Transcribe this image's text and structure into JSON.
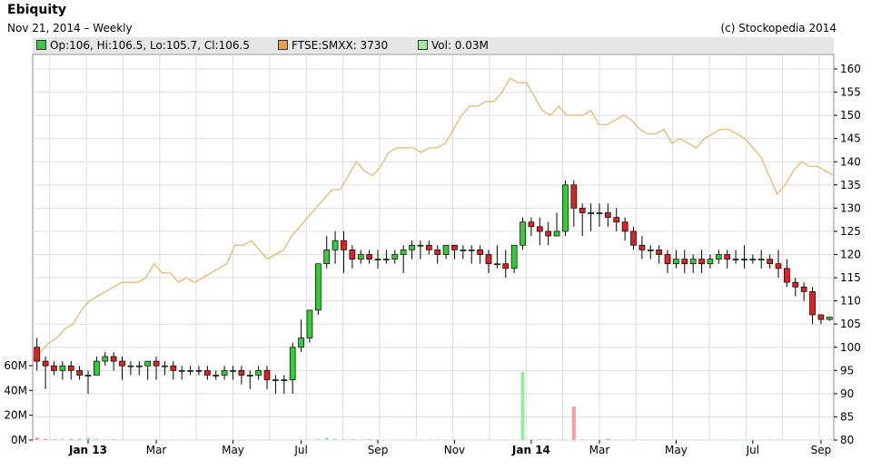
{
  "header": {
    "title": "Ebiquity",
    "subtitle": "Nov 21, 2014 – Weekly",
    "credit": "(c) Stockopedia 2014"
  },
  "legend": {
    "ohlc": "Op:106, Hi:106.5, Lo:105.7, Cl:106.5",
    "index": "FTSE:SMXX: 3730",
    "volume": "Vol: 0.03M"
  },
  "colors": {
    "up": "#33cc33",
    "down": "#dd2222",
    "index_line": "#e8b96a",
    "volume_up": "#99ee99",
    "volume_down": "#ff9999",
    "legend_bg": "#e6e6e6"
  },
  "chart_data": {
    "type": "line",
    "price_axis": {
      "ticks": [
        "160",
        "155",
        "150",
        "145",
        "140",
        "135",
        "130",
        "125",
        "120",
        "115",
        "110",
        "105",
        "100",
        "95",
        "90",
        "85",
        "80"
      ],
      "ylim": [
        80,
        160
      ]
    },
    "volume_axis": {
      "ticks": [
        "60M",
        "40M",
        "20M",
        "0M"
      ],
      "ylim": [
        0,
        60
      ]
    },
    "x_ticks": [
      {
        "label": "Jan 13",
        "bold": true,
        "i": 6
      },
      {
        "label": "Mar",
        "bold": false,
        "i": 14
      },
      {
        "label": "May",
        "bold": false,
        "i": 23
      },
      {
        "label": "Jul",
        "bold": false,
        "i": 31
      },
      {
        "label": "Sep",
        "bold": false,
        "i": 40
      },
      {
        "label": "Nov",
        "bold": false,
        "i": 49
      },
      {
        "label": "Jan 14",
        "bold": true,
        "i": 58
      },
      {
        "label": "Mar",
        "bold": false,
        "i": 66
      },
      {
        "label": "May",
        "bold": false,
        "i": 75
      },
      {
        "label": "Jul",
        "bold": false,
        "i": 84
      },
      {
        "label": "Sep",
        "bold": false,
        "i": 92
      },
      {
        "label": "Nov",
        "bold": false,
        "i": 101
      }
    ],
    "ohlc": [
      [
        100,
        102,
        95,
        97
      ],
      [
        97,
        98,
        91,
        96
      ],
      [
        96,
        97,
        94,
        95
      ],
      [
        95,
        97,
        93,
        96
      ],
      [
        96,
        97,
        93,
        95
      ],
      [
        95,
        96,
        93,
        94
      ],
      [
        94,
        95,
        90,
        94
      ],
      [
        94,
        98,
        94,
        97
      ],
      [
        97,
        99,
        96,
        98
      ],
      [
        98,
        99,
        95,
        97
      ],
      [
        97,
        98,
        93,
        96
      ],
      [
        96,
        97,
        94,
        96
      ],
      [
        96,
        97,
        94,
        96
      ],
      [
        96,
        97,
        93,
        97
      ],
      [
        97,
        98,
        93,
        96
      ],
      [
        96,
        97,
        94,
        96
      ],
      [
        96,
        97,
        93,
        95
      ],
      [
        95,
        96,
        93,
        95
      ],
      [
        95,
        96,
        94,
        95
      ],
      [
        95,
        96,
        94,
        95
      ],
      [
        95,
        96,
        93,
        94
      ],
      [
        94,
        95,
        93,
        94
      ],
      [
        94,
        96,
        93,
        95
      ],
      [
        95,
        96,
        93,
        95
      ],
      [
        95,
        96,
        92,
        94
      ],
      [
        94,
        95,
        91,
        94
      ],
      [
        94,
        96,
        93,
        95
      ],
      [
        95,
        96,
        91,
        93
      ],
      [
        93,
        94,
        90,
        93
      ],
      [
        93,
        94,
        90,
        93
      ],
      [
        93,
        101,
        90,
        100
      ],
      [
        100,
        106,
        99,
        102
      ],
      [
        102,
        108,
        101,
        108
      ],
      [
        108,
        118,
        107,
        118
      ],
      [
        118,
        124,
        117,
        121
      ],
      [
        121,
        125,
        118,
        123
      ],
      [
        123,
        125,
        116,
        121
      ],
      [
        121,
        122,
        117,
        119
      ],
      [
        119,
        121,
        118,
        120
      ],
      [
        120,
        121,
        118,
        119
      ],
      [
        119,
        121,
        117,
        119
      ],
      [
        119,
        121,
        118,
        119
      ],
      [
        119,
        121,
        118,
        120
      ],
      [
        120,
        122,
        116,
        121
      ],
      [
        121,
        123,
        119,
        122
      ],
      [
        122,
        123,
        119,
        122
      ],
      [
        122,
        123,
        120,
        121
      ],
      [
        121,
        122,
        118,
        120
      ],
      [
        120,
        122,
        119,
        122
      ],
      [
        122,
        122,
        119,
        121
      ],
      [
        121,
        122,
        119,
        121
      ],
      [
        121,
        122,
        118,
        121
      ],
      [
        121,
        122,
        118,
        120
      ],
      [
        120,
        121,
        116,
        118
      ],
      [
        118,
        122,
        117,
        118
      ],
      [
        118,
        121,
        115,
        117
      ],
      [
        117,
        122,
        116,
        122
      ],
      [
        122,
        128,
        121,
        127
      ],
      [
        127,
        128,
        124,
        126
      ],
      [
        126,
        128,
        122,
        125
      ],
      [
        125,
        127,
        122,
        124
      ],
      [
        124,
        129,
        124,
        125
      ],
      [
        125,
        136,
        124,
        135
      ],
      [
        135,
        136,
        126,
        130
      ],
      [
        130,
        131,
        124,
        129
      ],
      [
        129,
        131,
        125,
        129
      ],
      [
        129,
        131,
        126,
        129
      ],
      [
        129,
        131,
        126,
        128
      ],
      [
        128,
        130,
        125,
        127
      ],
      [
        127,
        128,
        123,
        125
      ],
      [
        125,
        126,
        121,
        122
      ],
      [
        122,
        124,
        119,
        121
      ],
      [
        121,
        122,
        119,
        121
      ],
      [
        121,
        122,
        118,
        120
      ],
      [
        120,
        121,
        116,
        118
      ],
      [
        118,
        121,
        117,
        119
      ],
      [
        119,
        121,
        116,
        118
      ],
      [
        118,
        120,
        116,
        119
      ],
      [
        119,
        121,
        116,
        118
      ],
      [
        118,
        120,
        117,
        119
      ],
      [
        119,
        121,
        118,
        120
      ],
      [
        120,
        121,
        117,
        119
      ],
      [
        119,
        121,
        118,
        119
      ],
      [
        119,
        122,
        117,
        119
      ],
      [
        119,
        120,
        118,
        119
      ],
      [
        119,
        121,
        117,
        119
      ],
      [
        119,
        120,
        117,
        118
      ],
      [
        118,
        121,
        115,
        117
      ],
      [
        117,
        119,
        113,
        114
      ],
      [
        114,
        115,
        111,
        113
      ],
      [
        113,
        114,
        110,
        112
      ],
      [
        112,
        113,
        105,
        107
      ],
      [
        107,
        107,
        105,
        106
      ],
      [
        106,
        106.5,
        105.7,
        106.5
      ]
    ],
    "index_close": [
      97,
      99,
      101,
      102,
      104,
      105,
      108,
      110,
      111,
      112,
      113,
      114,
      114,
      114,
      115,
      118,
      116,
      116,
      114,
      115,
      114,
      115,
      116,
      117,
      118,
      122,
      122,
      123,
      121,
      119,
      120,
      121,
      124,
      126,
      128,
      130,
      132,
      134,
      134,
      137,
      140,
      138,
      137,
      139,
      142,
      143,
      143,
      143,
      142,
      143,
      143,
      144,
      147,
      150,
      152,
      152,
      153,
      153,
      155,
      158,
      157,
      157,
      154,
      151,
      150,
      152,
      150,
      150,
      150,
      151,
      148,
      148,
      149,
      150,
      149,
      147,
      146,
      146,
      147,
      144,
      145,
      144,
      143,
      145,
      146,
      147,
      147,
      146,
      145,
      143,
      141,
      137,
      133,
      135,
      138,
      140,
      139,
      139,
      138,
      137
    ],
    "volume": [
      2,
      1,
      0.5,
      1,
      1,
      1,
      2,
      1,
      0.5,
      0.5,
      0.3,
      0.3,
      0.3,
      0.3,
      0.3,
      0.3,
      0.3,
      0.3,
      0.3,
      0.3,
      0.3,
      0.3,
      0.3,
      0.3,
      0.3,
      0.3,
      0.3,
      0.3,
      0.3,
      0.3,
      0.3,
      0.3,
      0.3,
      1,
      2,
      1,
      0.5,
      0.5,
      0.5,
      0.5,
      0.5,
      0.3,
      0.3,
      0.3,
      0.3,
      0.3,
      0.3,
      0.3,
      0.3,
      0.3,
      0.3,
      0.3,
      0.3,
      0.3,
      0.3,
      0.3,
      0.3,
      55,
      0.5,
      0.5,
      0.5,
      0.5,
      0.5,
      27,
      0.5,
      0.5,
      0.3,
      1,
      0.3,
      0.3,
      0.3,
      0.3,
      0.3,
      0.3,
      0.3,
      0.3,
      0.3,
      0.3,
      0.3,
      0.3,
      0.3,
      0.3,
      0.3,
      0.3,
      0.3,
      0.3,
      0.3,
      0.3,
      0.3,
      0.3,
      0.3,
      0.3,
      0.3,
      0.3,
      0.3,
      0.3,
      0.3,
      0.3,
      0.3,
      0.3,
      0.3
    ]
  }
}
